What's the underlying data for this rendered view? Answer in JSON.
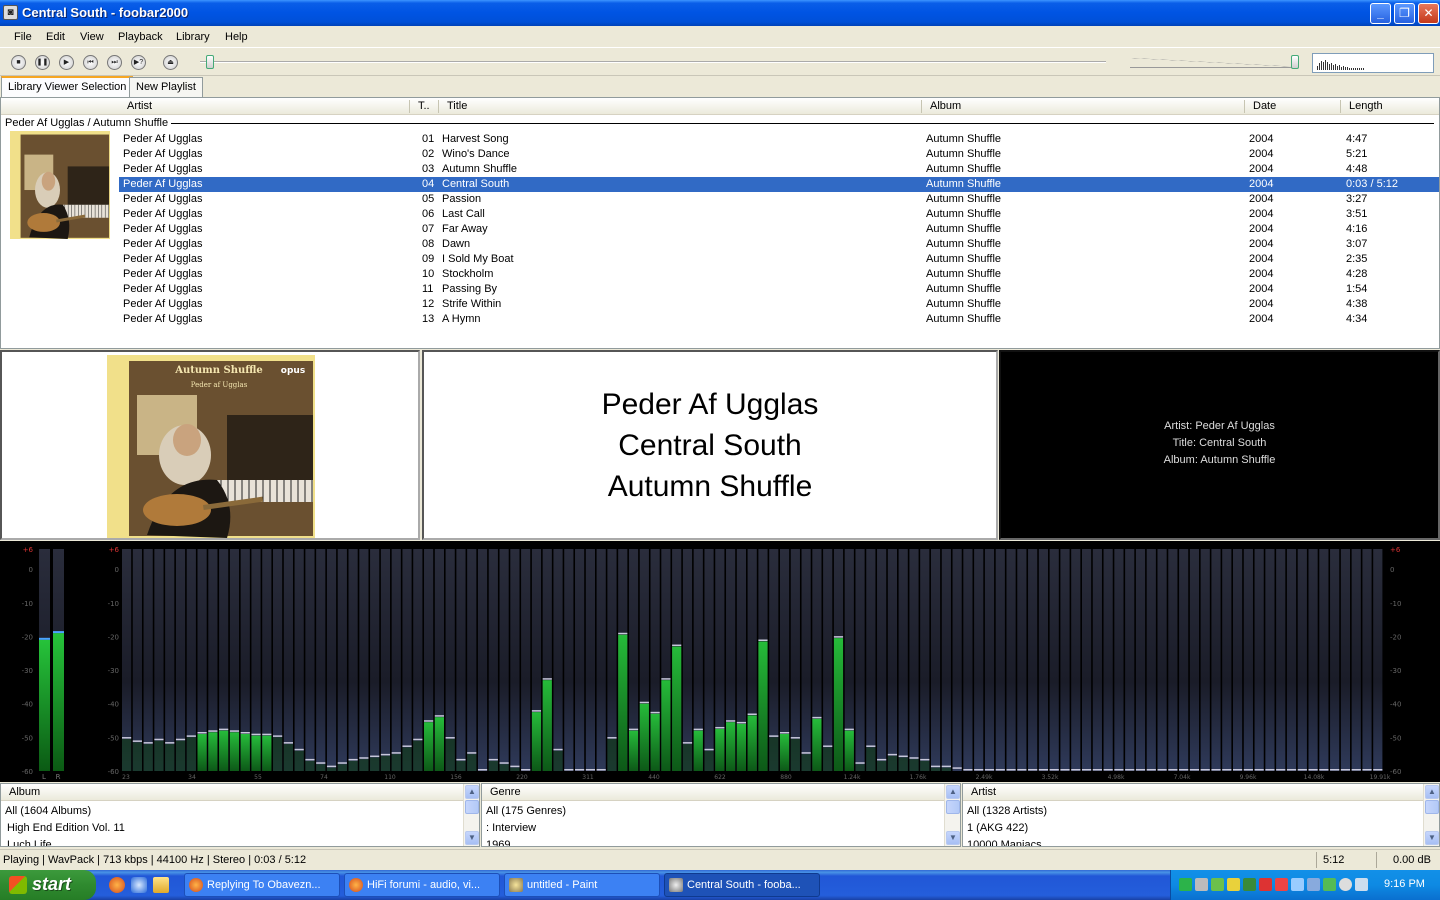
{
  "window": {
    "title": "Central South - foobar2000"
  },
  "menu": [
    "File",
    "Edit",
    "View",
    "Playback",
    "Library",
    "Help"
  ],
  "tabs": [
    "Library Viewer Selection",
    "New Playlist"
  ],
  "playlist": {
    "columns": {
      "artist": "Artist",
      "track": "T..",
      "title": "Title",
      "album": "Album",
      "date": "Date",
      "length": "Length"
    },
    "group_header": "Peder Af Ugglas / Autumn Shuffle",
    "rows": [
      {
        "artist": "Peder Af Ugglas",
        "track": "01",
        "title": "Harvest Song",
        "album": "Autumn Shuffle",
        "date": "2004",
        "length": "4:47"
      },
      {
        "artist": "Peder Af Ugglas",
        "track": "02",
        "title": "Wino's Dance",
        "album": "Autumn Shuffle",
        "date": "2004",
        "length": "5:21"
      },
      {
        "artist": "Peder Af Ugglas",
        "track": "03",
        "title": "Autumn Shuffle",
        "album": "Autumn Shuffle",
        "date": "2004",
        "length": "4:48"
      },
      {
        "artist": "Peder Af Ugglas",
        "track": "04",
        "title": "Central South",
        "album": "Autumn Shuffle",
        "date": "2004",
        "length": "0:03 / 5:12",
        "selected": true
      },
      {
        "artist": "Peder Af Ugglas",
        "track": "05",
        "title": "Passion",
        "album": "Autumn Shuffle",
        "date": "2004",
        "length": "3:27"
      },
      {
        "artist": "Peder Af Ugglas",
        "track": "06",
        "title": "Last Call",
        "album": "Autumn Shuffle",
        "date": "2004",
        "length": "3:51"
      },
      {
        "artist": "Peder Af Ugglas",
        "track": "07",
        "title": "Far Away",
        "album": "Autumn Shuffle",
        "date": "2004",
        "length": "4:16"
      },
      {
        "artist": "Peder Af Ugglas",
        "track": "08",
        "title": "Dawn",
        "album": "Autumn Shuffle",
        "date": "2004",
        "length": "3:07"
      },
      {
        "artist": "Peder Af Ugglas",
        "track": "09",
        "title": "I Sold My Boat",
        "album": "Autumn Shuffle",
        "date": "2004",
        "length": "2:35"
      },
      {
        "artist": "Peder Af Ugglas",
        "track": "10",
        "title": "Stockholm",
        "album": "Autumn Shuffle",
        "date": "2004",
        "length": "4:28"
      },
      {
        "artist": "Peder Af Ugglas",
        "track": "11",
        "title": "Passing By",
        "album": "Autumn Shuffle",
        "date": "2004",
        "length": "1:54"
      },
      {
        "artist": "Peder Af Ugglas",
        "track": "12",
        "title": "Strife Within",
        "album": "Autumn Shuffle",
        "date": "2004",
        "length": "4:38"
      },
      {
        "artist": "Peder Af Ugglas",
        "track": "13",
        "title": "A Hymn",
        "album": "Autumn Shuffle",
        "date": "2004",
        "length": "4:34"
      }
    ]
  },
  "cover": {
    "title": "Autumn Shuffle",
    "artist": "Peder af Ugglas",
    "label": "opus"
  },
  "now_playing": {
    "line1": "Peder Af Ugglas",
    "line2": "Central South",
    "line3": "Autumn Shuffle"
  },
  "info": {
    "artist": "Artist: Peder Af Ugglas",
    "title": "Title: Central South",
    "album": "Album: Autumn Shuffle"
  },
  "spectrum": {
    "db_labels": [
      "+6",
      "0",
      "-10",
      "-20",
      "-30",
      "-40",
      "-50",
      "-60"
    ],
    "freq_labels": [
      "23",
      "34",
      "55",
      "74",
      "110",
      "156",
      "220",
      "311",
      "440",
      "622",
      "880",
      "1.24k",
      "1.76k",
      "2.49k",
      "3.52k",
      "4.98k",
      "7.04k",
      "9.96k",
      "14.08k",
      "19.91k"
    ],
    "vu_labels": [
      "L",
      "R"
    ],
    "vu_levels_db": [
      -21,
      -19
    ],
    "bar_levels_db": [
      -50.5,
      -51.5,
      -52,
      -51,
      -52,
      -51,
      -50,
      -49,
      -48.5,
      -48,
      -48.5,
      -49,
      -49.5,
      -49.5,
      -50,
      -52,
      -54,
      -57,
      -58,
      -59,
      -58,
      -57,
      -56.5,
      -56,
      -55.5,
      -55,
      -53,
      -51,
      -45.5,
      -44,
      -50.5,
      -57,
      -55,
      -60,
      -57,
      -58,
      -59,
      -60,
      -42.5,
      -33,
      -54,
      -60,
      -60,
      -60,
      -60,
      -50.5,
      -19.5,
      -48,
      -40,
      -43,
      -33,
      -23,
      -52,
      -48,
      -54,
      -47.5,
      -45.5,
      -46,
      -43.5,
      -21.5,
      -50,
      -49,
      -50.5,
      -55,
      -44.5,
      -53,
      -20.5,
      -48,
      -58,
      -53,
      -57,
      -55.5,
      -56,
      -56.5,
      -57,
      -59,
      -59,
      -59.5,
      -60,
      -60,
      -60,
      -60,
      -60,
      -60,
      -60,
      -60,
      -60,
      -60,
      -60,
      -60,
      -60,
      -60,
      -60,
      -60,
      -60,
      -60,
      -60,
      -60,
      -60,
      -60,
      -60,
      -60,
      -60,
      -60,
      -60,
      -60,
      -60,
      -60,
      -60,
      -60,
      -60,
      -60,
      -60,
      -60,
      -60,
      -60,
      -60
    ]
  },
  "browsers": {
    "album": {
      "header": "Album",
      "items": [
        "All (1604 Albums)",
        "High End Edition Vol. 11",
        "Luch Life"
      ]
    },
    "genre": {
      "header": "Genre",
      "items": [
        "All (175 Genres)",
        ": Interview",
        "1969"
      ]
    },
    "artist": {
      "header": "Artist",
      "items": [
        "All (1328 Artists)",
        "1 (AKG 422)",
        "10000 Maniacs"
      ]
    }
  },
  "status": {
    "text": "Playing | WavPack | 713 kbps | 44100 Hz | Stereo | 0:03 / 5:12",
    "total": "5:12",
    "gain": "0.00 dB"
  },
  "taskbar": {
    "start": "start",
    "tasks": [
      "Replying To Obavezn...",
      "HiFi forumi - audio, vi...",
      "untitled - Paint",
      "Central South - fooba..."
    ],
    "clock": "9:16 PM"
  },
  "colors": {
    "selection": "#316ac5",
    "titlebar": "#0054e3",
    "spectrum_bar": "#1aa02a",
    "peak": "#c0c0d8",
    "taskbar": "#245edb"
  }
}
